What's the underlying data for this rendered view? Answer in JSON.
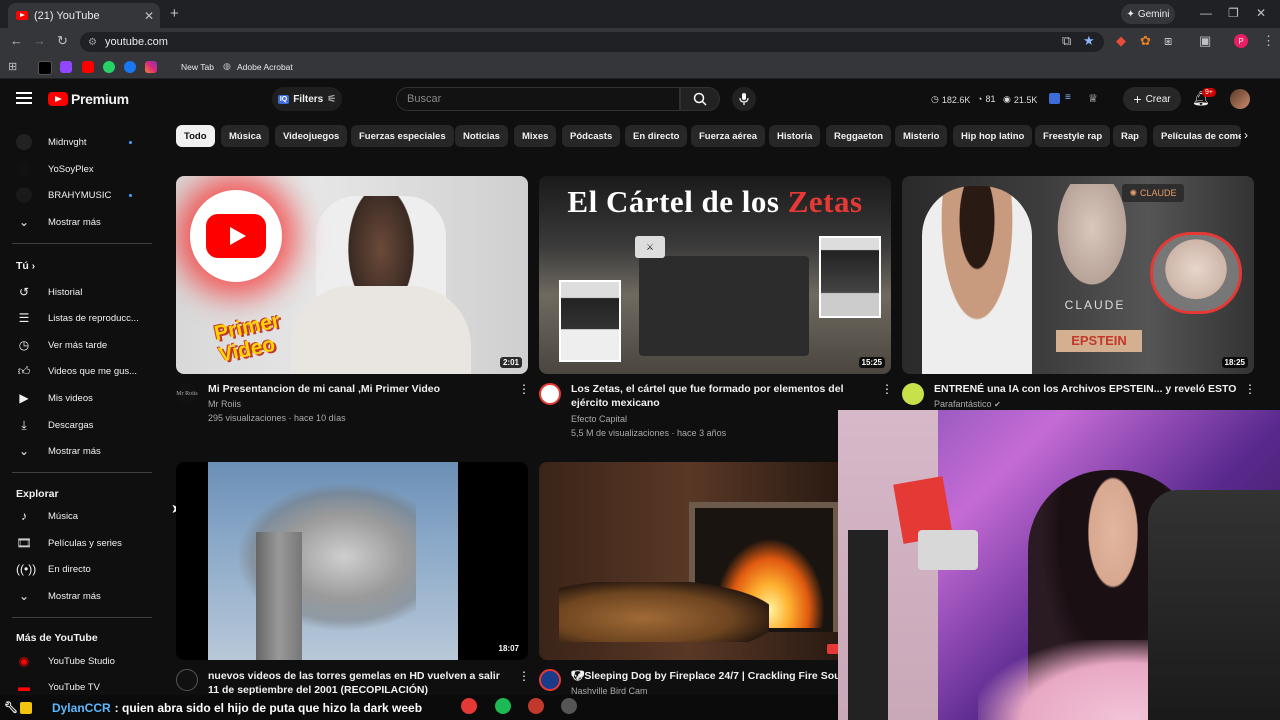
{
  "browser": {
    "tab_title": "(21) YouTube",
    "new_tab_symbol": "+",
    "url": "youtube.com",
    "gemini_label": "Gemini",
    "bookmarks": [
      "New Tab",
      "Adobe Acrobat"
    ]
  },
  "header": {
    "logo_text": "Premium",
    "filters_label": "Filters",
    "search_placeholder": "Buscar",
    "stats": [
      {
        "icon": "clock-icon",
        "value": "182.6K"
      },
      {
        "icon": "thumbs-up-icon",
        "value": "81"
      },
      {
        "icon": "eye-icon",
        "value": "21.5K"
      }
    ],
    "create_label": "Crear",
    "notifications_badge": "9+"
  },
  "sidebar": {
    "subscriptions": [
      {
        "label": "Midnvght",
        "dot": true
      },
      {
        "label": "YoSoyPlex",
        "dot": false
      },
      {
        "label": "BRAHYMUSIC",
        "dot": true
      }
    ],
    "show_more": "Mostrar más",
    "you_heading": "Tú",
    "you_items": [
      "Historial",
      "Listas de reproducc...",
      "Ver más tarde",
      "Videos que me gus...",
      "Mis videos",
      "Descargas",
      "Mostrar más"
    ],
    "explore_heading": "Explorar",
    "explore_items": [
      "Música",
      "Películas y series",
      "En directo",
      "Mostrar más"
    ],
    "more_heading": "Más de YouTube",
    "more_items": [
      "YouTube Studio",
      "YouTube TV"
    ]
  },
  "chips": [
    "Todo",
    "Música",
    "Videojuegos",
    "Fuerzas especiales",
    "Noticias",
    "Mixes",
    "Pódcasts",
    "En directo",
    "Fuerza aérea",
    "Historia",
    "Reggaeton",
    "Misterio",
    "Hip hop latino",
    "Freestyle rap",
    "Rap",
    "Películas de comec"
  ],
  "videos": [
    {
      "title": "Mi Presentancion de mi canal ,Mi Primer Video",
      "channel": "Mr Roiis",
      "meta": "295 visualizaciones · hace 10 días",
      "duration": "2:01",
      "thumb_text": "Primer Video",
      "channel_avatar_text": "Mr Roiis"
    },
    {
      "title": "Los Zetas, el cártel que fue formado por elementos del ejército mexicano",
      "channel": "Efecto Capital",
      "meta": "5,5 M de visualizaciones · hace 3 años",
      "duration": "15:25",
      "thumb_text_a": "El Cártel de los ",
      "thumb_text_b": "Zetas"
    },
    {
      "title": "ENTRENÉ una IA con los Archivos EPSTEIN... y reveló ESTO",
      "channel": "Parafantástico",
      "meta": "",
      "duration": "18:25",
      "thumb_text_a": "CLAUDE",
      "thumb_text_b": "EPSTEIN",
      "thumb_text_c": "CLAUDE"
    },
    {
      "title": "nuevos videos de las torres gemelas en HD vuelven a salir 11 de septiembre del 2001 (RECOPILACIÓN)",
      "channel": "",
      "meta": "",
      "duration": "18:07"
    },
    {
      "title": "Sleeping Dog by Fireplace 24/7 | Crackling Fire Sou",
      "channel": "Nashville Bird Cam",
      "meta": "",
      "duration": ""
    }
  ],
  "chat": {
    "user": "DylanCCR",
    "message": ": quien abra sido el hijo de puta que hizo la dark weeb"
  }
}
